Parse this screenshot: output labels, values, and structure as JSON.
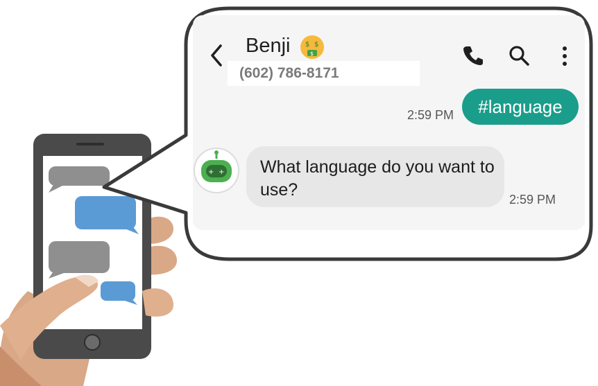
{
  "contact": {
    "name": "Benji",
    "phone": "(602) 786-8171"
  },
  "icons": {
    "back": "chevron-left-icon",
    "call": "phone-icon",
    "search": "search-icon",
    "more": "more-vertical-icon",
    "emoji": "money-mouth-face-icon",
    "avatar": "robot-icon"
  },
  "messages": [
    {
      "direction": "sent",
      "text": "#language",
      "time": "2:59 PM"
    },
    {
      "direction": "received",
      "text": "What language do you want to use?",
      "time": "2:59 PM"
    }
  ],
  "colors": {
    "sent_bubble": "#1a9e8b",
    "received_bubble": "#e7e7e7",
    "robot_green": "#4caf50"
  }
}
